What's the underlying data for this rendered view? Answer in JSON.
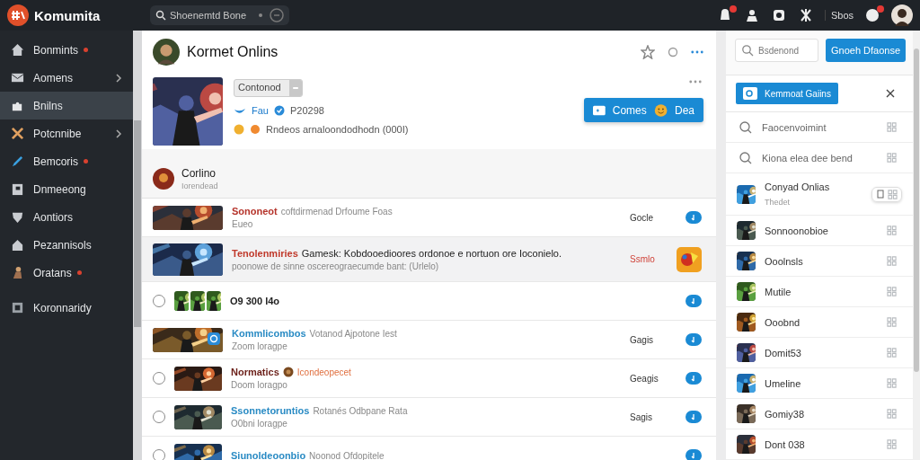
{
  "app": {
    "name": "Komumita"
  },
  "search": {
    "placeholder": "Shoenemtd Bone"
  },
  "topbar": {
    "user_label": "Sbos",
    "notifications_unread": true,
    "messages_unread": true
  },
  "sidebar": {
    "items": [
      {
        "label": "Bonmints",
        "kind": "link",
        "unread": true,
        "selected": false
      },
      {
        "label": "Aomens",
        "kind": "group",
        "unread": false,
        "selected": false
      },
      {
        "label": "Bnilns",
        "kind": "link",
        "unread": false,
        "selected": true
      },
      {
        "label": "Potcnnibe",
        "kind": "group",
        "unread": false,
        "selected": false
      },
      {
        "label": "Bemcoris",
        "kind": "link",
        "unread": true,
        "selected": false
      },
      {
        "label": "Dnmeeong",
        "kind": "link",
        "unread": false,
        "selected": false
      },
      {
        "label": "Aontiors",
        "kind": "link",
        "unread": false,
        "selected": false
      },
      {
        "label": "Pezannisols",
        "kind": "link",
        "unread": false,
        "selected": false
      },
      {
        "label": "Oratans",
        "kind": "link",
        "unread": true,
        "selected": false
      },
      {
        "label": "Koronnaridy",
        "kind": "footer",
        "unread": false,
        "selected": false
      }
    ]
  },
  "page": {
    "title": "Kormet Onlins"
  },
  "game": {
    "status_button": "Contonod",
    "platform": "Fau",
    "code": "P20298",
    "description": "Rndeos arnaloondodhodn (000I)",
    "action_label": "Comes",
    "action_extra": "Dea"
  },
  "section": {
    "title": "Corlino",
    "subtitle": "Iorendead"
  },
  "rows": [
    {
      "kind": "plain",
      "thumbnails": [
        {
          "kind": "picture",
          "badge": false
        }
      ],
      "selected": false,
      "lead": "Sononeot",
      "color": "#b5332a",
      "title": "coftdirmenad Drfoume Foas",
      "subtitle": "Eueo",
      "tag": "Gocle"
    },
    {
      "kind": "featured",
      "thumbnails": [
        {
          "kind": "picture",
          "badge": false
        }
      ],
      "selected": true,
      "lead": "Tenolenmiries",
      "color": "#c0392b",
      "title": "Gamesk: Kobdooedioores ordonoe e nortuon ore Ioconielo.",
      "subtitle": "poonowe de sinne oscereograecumde bant: (Urlelo)",
      "tag": "Ssmlo"
    },
    {
      "kind": "radio",
      "thumbnails": [
        {
          "kind": "picture",
          "badge": false
        },
        {
          "kind": "picture",
          "badge": false
        },
        {
          "kind": "picture",
          "badge": false
        }
      ],
      "selected": false,
      "lead": "O9 300 l4o",
      "color": "#222222"
    },
    {
      "kind": "plain",
      "thumbnails": [
        {
          "kind": "picture",
          "badge": true
        }
      ],
      "selected": false,
      "lead": "Kommlicombos",
      "color": "#2a8bc4",
      "title": "Votanod Ajpotone Iest",
      "subtitle": "Zoom loragpe",
      "tag": "Gagis"
    },
    {
      "kind": "radio",
      "thumbnails": [
        {
          "kind": "picture",
          "badge": false
        }
      ],
      "selected": false,
      "lead": "Normatics",
      "color": "#6b1f18",
      "note": "Icondeopecet",
      "subtitle": "Doom loragpo",
      "tag": "Geagis"
    },
    {
      "kind": "radio",
      "thumbnails": [
        {
          "kind": "picture",
          "badge": false
        }
      ],
      "selected": false,
      "lead": "Ssonnetoruntios",
      "color": "#2a8bc4",
      "title": "Rotanés Odbpane Rata",
      "subtitle": "O0bni loragpe",
      "tag": "Sagis"
    },
    {
      "kind": "radio",
      "thumbnails": [
        {
          "kind": "picture",
          "badge": false
        }
      ],
      "selected": false,
      "lead": "Siunoldeoonbio",
      "color": "#2a8bc4",
      "title": "Noonod Ofdopitele"
    }
  ],
  "panel": {
    "search_placeholder": "Bsdenond",
    "button": "Gnoeh Dfaonse",
    "chip": "Kemmoat Gaiins",
    "items": [
      {
        "kind": "recent",
        "label": "Faocenvoimint",
        "hovered": false
      },
      {
        "kind": "recent",
        "label": "Kiona elea dee bend",
        "hovered": false
      },
      {
        "kind": "game",
        "label": "Conyad Onlias",
        "subtitle": "Thedet",
        "hovered": true
      },
      {
        "kind": "game",
        "label": "Sonnoonobioe",
        "hovered": false
      },
      {
        "kind": "game",
        "label": "Ooolnsls",
        "hovered": false
      },
      {
        "kind": "game",
        "label": "Mutile",
        "hovered": false
      },
      {
        "kind": "game",
        "label": "Ooobnd",
        "hovered": false
      },
      {
        "kind": "game",
        "label": "Domit53",
        "hovered": false
      },
      {
        "kind": "game",
        "label": "Umeline",
        "hovered": false
      },
      {
        "kind": "game",
        "label": "Gomiy38",
        "hovered": false
      },
      {
        "kind": "game",
        "label": "Dont 038",
        "hovered": false
      }
    ]
  }
}
